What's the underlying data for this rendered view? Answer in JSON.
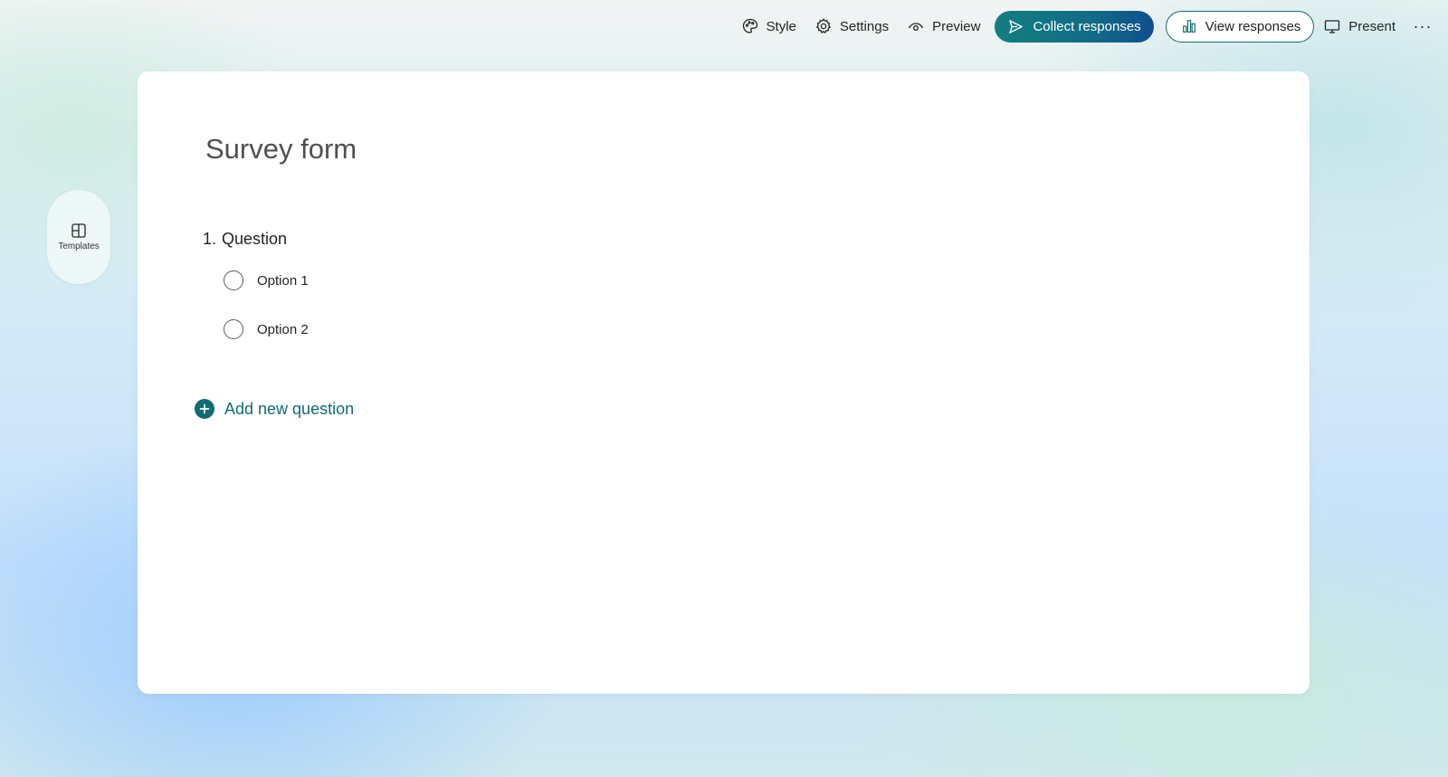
{
  "toolbar": {
    "style_label": "Style",
    "settings_label": "Settings",
    "preview_label": "Preview",
    "collect_label": "Collect responses",
    "view_label": "View responses",
    "present_label": "Present",
    "more_label": "···"
  },
  "sidebar": {
    "templates_label": "Templates"
  },
  "form": {
    "title": "Survey form",
    "questions": [
      {
        "number": "1.",
        "title": "Question",
        "options": [
          "Option 1",
          "Option 2"
        ]
      }
    ],
    "add_question_label": "Add new question"
  },
  "colors": {
    "accent": "#0f6c74",
    "collect_gradient_start": "#137e80",
    "collect_gradient_end": "#0f4f8f"
  }
}
